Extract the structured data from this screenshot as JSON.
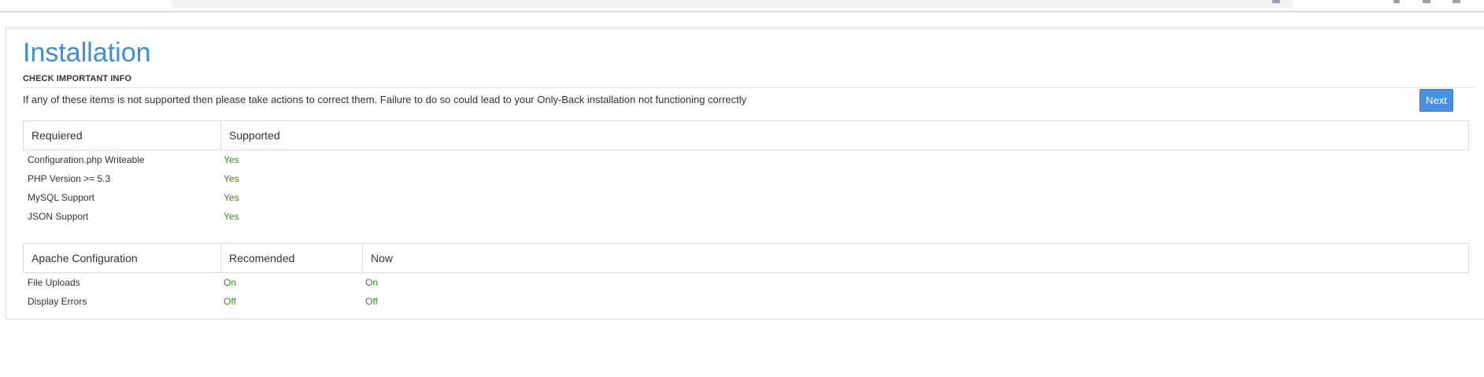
{
  "page": {
    "title": "Installation",
    "section_heading": "CHECK IMPORTANT INFO",
    "intro_text": "If any of these items is not supported then please take actions to correct them. Failure to do so could lead to your Only-Back installation not functioning correctly",
    "next_label": "Next"
  },
  "requirements_table": {
    "headers": [
      "Requiered",
      "Supported"
    ],
    "rows": [
      {
        "item": "Configuration.php Writeable",
        "status": "Yes"
      },
      {
        "item": "PHP Version >= 5.3",
        "status": "Yes"
      },
      {
        "item": "MySQL Support",
        "status": "Yes"
      },
      {
        "item": "JSON Support",
        "status": "Yes"
      }
    ]
  },
  "apache_table": {
    "headers": [
      "Apache Configuration",
      "Recomended",
      "Now"
    ],
    "rows": [
      {
        "item": "File Uploads",
        "recommended": "On",
        "now": "On"
      },
      {
        "item": "Display Errors",
        "recommended": "Off",
        "now": "Off"
      }
    ]
  },
  "colors": {
    "accent": "#3b8fe0",
    "button": "#4a90e2",
    "status_ok": "#3c8a22"
  }
}
